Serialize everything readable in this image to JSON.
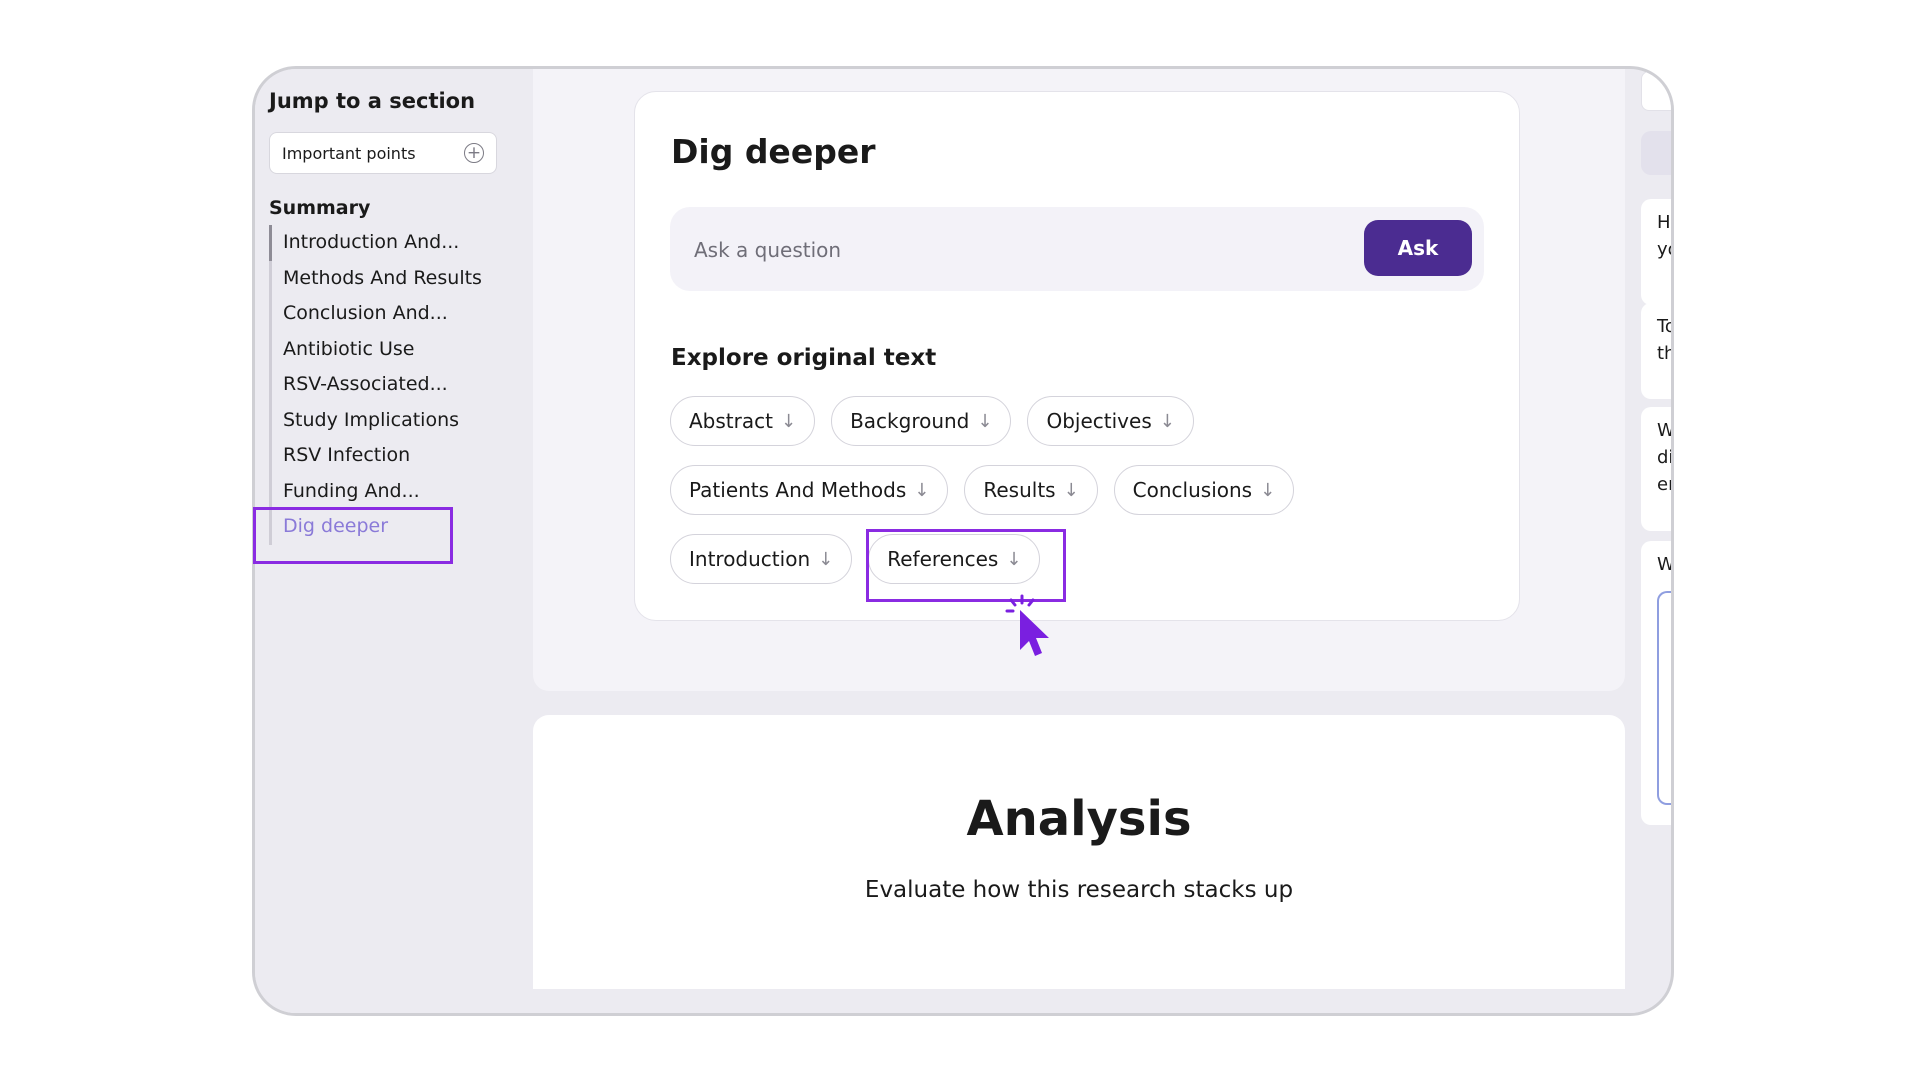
{
  "sidebar": {
    "jump_title": "Jump to a section",
    "important_points_label": "Important points",
    "summary_heading": "Summary",
    "items": [
      {
        "label": "Introduction And..."
      },
      {
        "label": "Methods And Results"
      },
      {
        "label": "Conclusion And..."
      },
      {
        "label": "Antibiotic Use"
      },
      {
        "label": "RSV-Associated..."
      },
      {
        "label": "Study Implications"
      },
      {
        "label": "RSV Infection"
      },
      {
        "label": "Funding And..."
      },
      {
        "label": "Dig deeper"
      }
    ],
    "active_item": "Dig deeper"
  },
  "dig_deeper": {
    "title": "Dig deeper",
    "ask_placeholder": "Ask a question",
    "ask_button": "Ask",
    "explore_title": "Explore original text",
    "chips": [
      {
        "label": "Abstract"
      },
      {
        "label": "Background"
      },
      {
        "label": "Objectives"
      },
      {
        "label": "Patients And Methods"
      },
      {
        "label": "Results"
      },
      {
        "label": "Conclusions"
      },
      {
        "label": "Introduction"
      },
      {
        "label": "References"
      }
    ]
  },
  "analysis": {
    "title": "Analysis",
    "subtitle": "Evaluate how this research stacks up"
  },
  "peek": {
    "cards": [
      "He\nyo",
      "To\nth",
      "W\ndi\ner",
      "W"
    ]
  },
  "icons": {
    "add": "plus-circle-icon",
    "chip_arrow": "arrow-down-icon",
    "pointer": "cursor-pointer-icon"
  },
  "colors": {
    "accent": "#4b2c91",
    "highlight": "#8a2be2",
    "active_nav": "#8a7ad8",
    "cursor": "#7a1fe0"
  }
}
